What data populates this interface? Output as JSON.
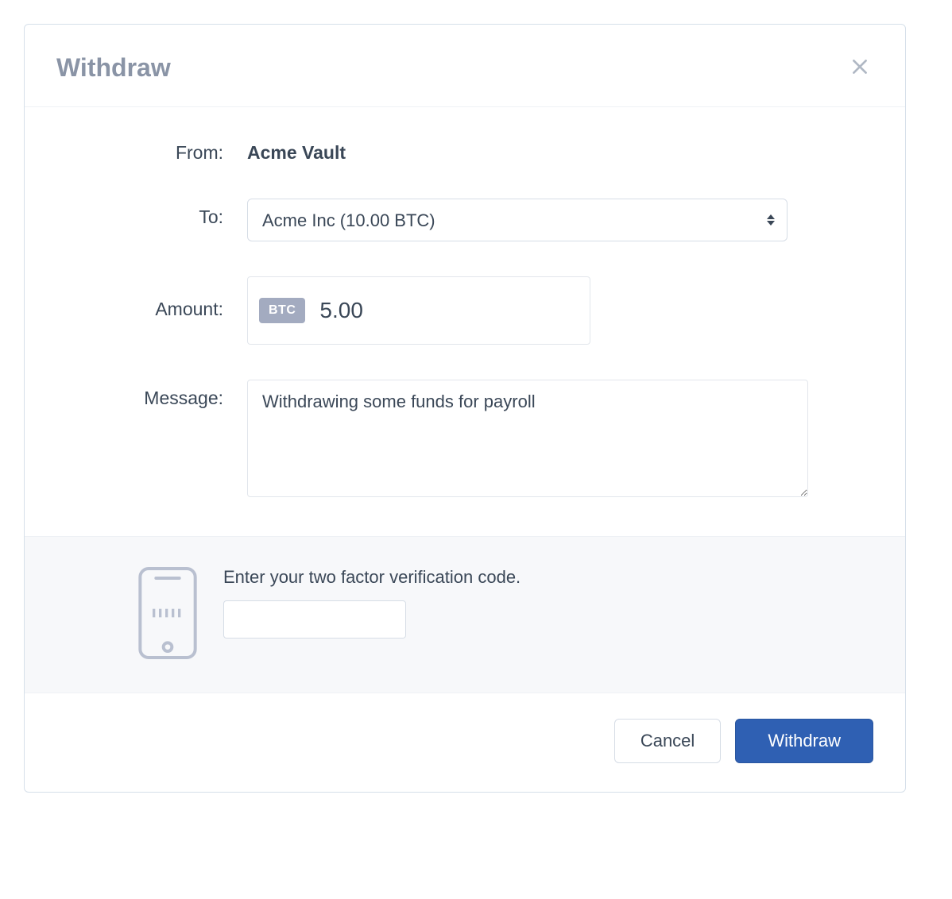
{
  "header": {
    "title": "Withdraw"
  },
  "form": {
    "from_label": "From:",
    "from_value": "Acme Vault",
    "to_label": "To:",
    "to_value": "Acme Inc (10.00 BTC)",
    "amount_label": "Amount:",
    "amount_currency": "BTC",
    "amount_value": "5.00",
    "message_label": "Message:",
    "message_value": "Withdrawing some funds for payroll"
  },
  "twofa": {
    "prompt": "Enter your two factor verification code.",
    "code_value": ""
  },
  "footer": {
    "cancel_label": "Cancel",
    "submit_label": "Withdraw"
  }
}
